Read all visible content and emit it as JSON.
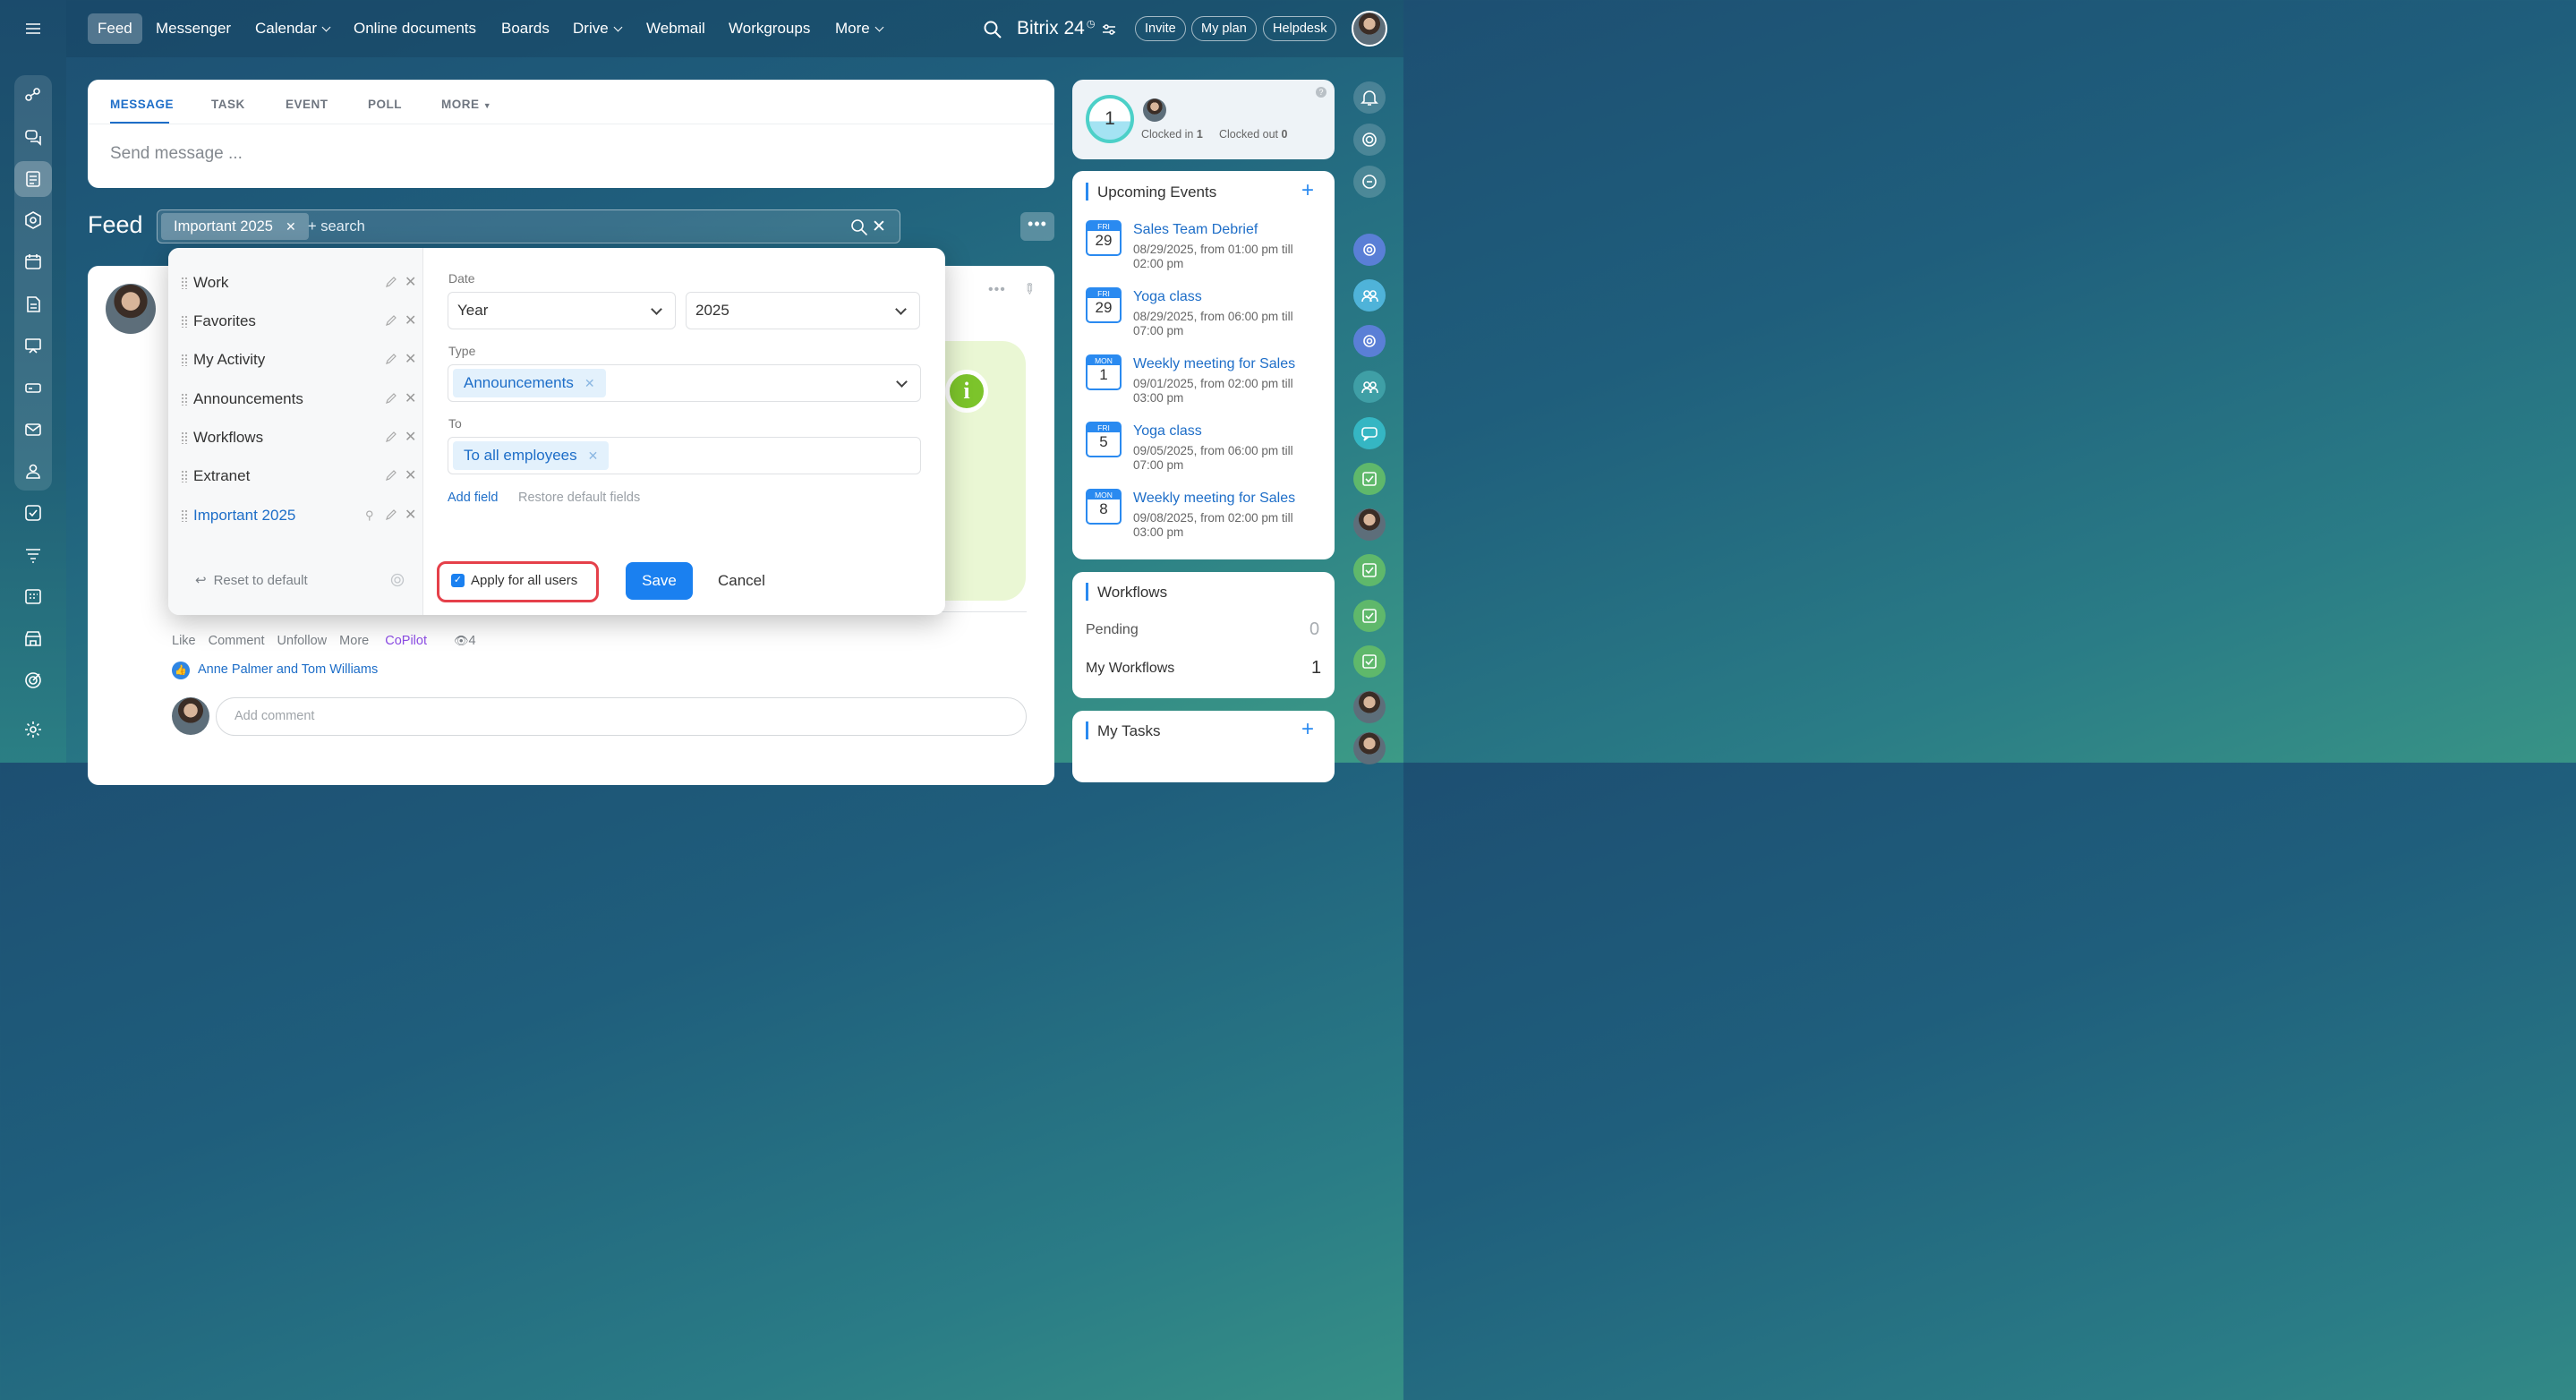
{
  "nav": {
    "items": [
      "Feed",
      "Messenger",
      "Calendar",
      "Online documents",
      "Boards",
      "Drive",
      "Webmail",
      "Workgroups",
      "More"
    ],
    "brand": "Bitrix 24",
    "invite": "Invite",
    "my_plan": "My plan",
    "helpdesk": "Helpdesk"
  },
  "composer": {
    "tabs": [
      "MESSAGE",
      "TASK",
      "EVENT",
      "POLL",
      "MORE"
    ],
    "placeholder": "Send message ..."
  },
  "feed": {
    "title": "Feed",
    "active_filter": "Important 2025",
    "search_placeholder": "+ search"
  },
  "presets": {
    "items": [
      "Work",
      "Favorites",
      "My Activity",
      "Announcements",
      "Workflows",
      "Extranet",
      "Important 2025"
    ],
    "reset": "Reset to default"
  },
  "filter": {
    "date_label": "Date",
    "date_period": "Year",
    "date_value": "2025",
    "type_label": "Type",
    "type_tag": "Announcements",
    "to_label": "To",
    "to_tag": "To all employees",
    "add_field": "Add field",
    "restore": "Restore default fields",
    "apply_all": "Apply for all users",
    "save": "Save",
    "cancel": "Cancel"
  },
  "post": {
    "actions": [
      "Like",
      "Comment",
      "Unfollow",
      "More",
      "CoPilot"
    ],
    "views": "4",
    "likes": "Anne Palmer and Tom Williams",
    "comment_placeholder": "Add comment"
  },
  "clock": {
    "count": "1",
    "clocked_in_label": "Clocked in",
    "clocked_in": "1",
    "clocked_out_label": "Clocked out",
    "clocked_out": "0"
  },
  "events": {
    "title": "Upcoming Events",
    "items": [
      {
        "dow": "FRI",
        "day": "29",
        "title": "Sales Team Debrief",
        "when": "08/29/2025, from 01:00 pm till 02:00 pm"
      },
      {
        "dow": "FRI",
        "day": "29",
        "title": "Yoga class",
        "when": "08/29/2025, from 06:00 pm till 07:00 pm"
      },
      {
        "dow": "MON",
        "day": "1",
        "title": "Weekly meeting for Sales",
        "when": "09/01/2025, from 02:00 pm till 03:00 pm"
      },
      {
        "dow": "FRI",
        "day": "5",
        "title": "Yoga class",
        "when": "09/05/2025, from 06:00 pm till 07:00 pm"
      },
      {
        "dow": "MON",
        "day": "8",
        "title": "Weekly meeting for Sales",
        "when": "09/08/2025, from 02:00 pm till 03:00 pm"
      }
    ]
  },
  "workflows": {
    "title": "Workflows",
    "pending_label": "Pending",
    "pending": "0",
    "mine_label": "My Workflows",
    "mine": "1"
  },
  "tasks": {
    "title": "My Tasks"
  },
  "colors": {
    "accent": "#1e6ec8",
    "save": "#1a80f0",
    "highlight": "#e5404a"
  }
}
